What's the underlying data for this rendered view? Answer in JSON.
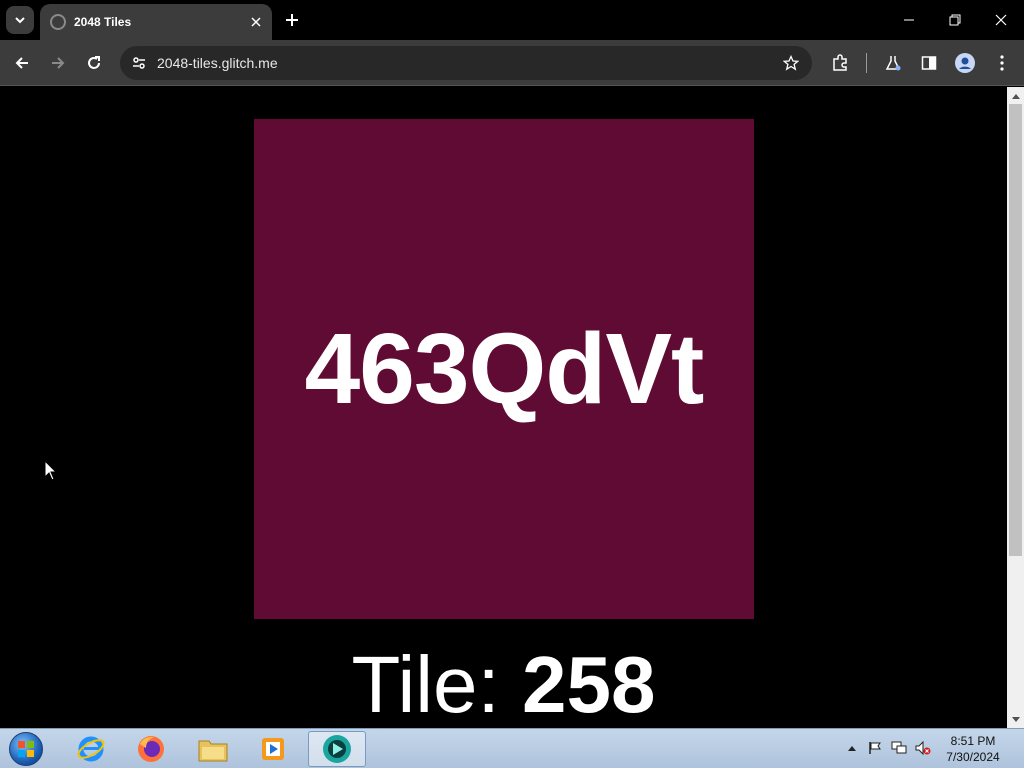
{
  "browser": {
    "tab_title": "2048 Tiles",
    "url": "2048-tiles.glitch.me"
  },
  "page": {
    "tile_text": "463QdVt",
    "tile_color": "#600b33",
    "caption_prefix": "Tile:",
    "caption_value": "258"
  },
  "taskbar": {
    "apps": [
      "internet-explorer",
      "firefox",
      "file-explorer",
      "media-player",
      "active-app"
    ],
    "time": "8:51 PM",
    "date": "7/30/2024"
  }
}
